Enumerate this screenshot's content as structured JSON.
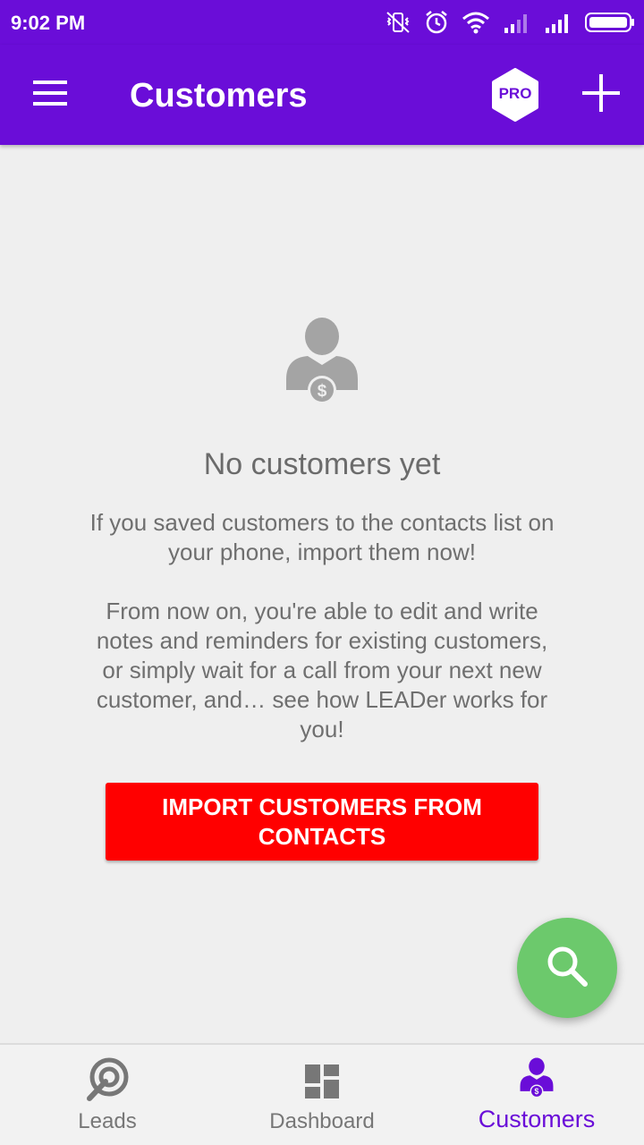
{
  "status_bar": {
    "time": "9:02 PM",
    "icons": [
      "vibrate-off-icon",
      "alarm-icon",
      "wifi-icon",
      "signal-weak-icon",
      "signal-full-icon",
      "battery-icon"
    ]
  },
  "app_bar": {
    "title": "Customers",
    "pro_label": "PRO",
    "menu_icon": "hamburger-menu-icon",
    "add_icon": "plus-icon"
  },
  "empty_state": {
    "icon": "customer-dollar-icon",
    "title": "No customers yet",
    "paragraph1": "If you saved customers to the contacts list on your phone, import them now!",
    "paragraph2": "From now on, you're able to edit and write notes and reminders for existing customers, or simply wait for a call from your next new customer, and… see how LEADer works for you!",
    "import_button": "IMPORT CUSTOMERS FROM CONTACTS"
  },
  "fab": {
    "icon": "search-icon"
  },
  "bottom_nav": {
    "items": [
      {
        "label": "Leads",
        "icon": "leads-target-icon"
      },
      {
        "label": "Dashboard",
        "icon": "dashboard-icon"
      },
      {
        "label": "Customers",
        "icon": "customer-dollar-icon",
        "active": true
      }
    ]
  },
  "colors": {
    "primary": "#6a0dd8",
    "import_button": "#ff0000",
    "fab": "#6cc96c",
    "inactive_icon": "#777777"
  }
}
